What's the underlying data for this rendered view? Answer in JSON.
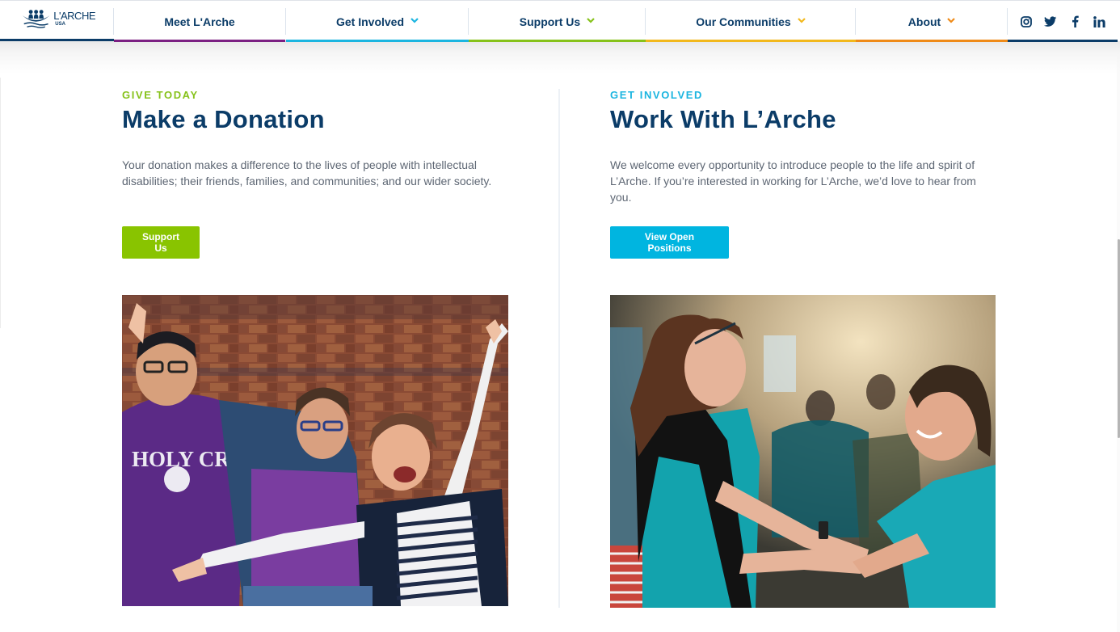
{
  "header": {
    "logo": {
      "name": "L'ARCHE",
      "sub": "USA"
    },
    "nav": [
      {
        "label": "Meet L'Arche",
        "has_dropdown": false,
        "accent": "#7b1f82"
      },
      {
        "label": "Get Involved",
        "has_dropdown": true,
        "accent": "#1bb5e0"
      },
      {
        "label": "Support Us",
        "has_dropdown": true,
        "accent": "#86c21a"
      },
      {
        "label": "Our Communities",
        "has_dropdown": true,
        "accent": "#f2b81c"
      },
      {
        "label": "About",
        "has_dropdown": true,
        "accent": "#ef8a17"
      }
    ],
    "social": [
      {
        "name": "instagram-icon",
        "label": "Instagram"
      },
      {
        "name": "twitter-icon",
        "label": "Twitter"
      },
      {
        "name": "facebook-icon",
        "label": "Facebook"
      },
      {
        "name": "linkedin-icon",
        "label": "LinkedIn"
      }
    ],
    "brand_color": "#0b3c68"
  },
  "donation": {
    "eyebrow": "GIVE TODAY",
    "eyebrow_color": "#86c21a",
    "title": "Make a Donation",
    "description": "Your donation makes a difference to the lives of people with intellectual disabilities; their friends, families, and communities; and our wider society.",
    "button_label": "Support Us",
    "button_color": "#89c400",
    "image_alt": "Three friends smiling and raising their arms in front of a brick wall"
  },
  "work": {
    "eyebrow": "GET INVOLVED",
    "eyebrow_color": "#1bb5e0",
    "title": "Work With L’Arche",
    "description": "We welcome every opportunity to introduce people to the life and spirit of L’Arche. If you’re interested in working for L’Arche, we’d love to hear from you.",
    "button_label": "View Open Positions",
    "button_color": "#00b5e0",
    "image_alt": "Two people in teal shirts holding hands and smiling at each other"
  }
}
